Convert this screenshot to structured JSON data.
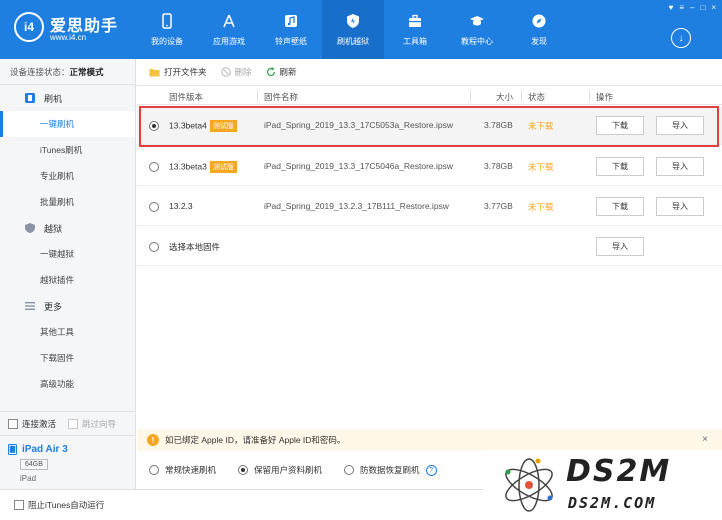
{
  "header": {
    "app_name": "爱思助手",
    "url": "www.i4.cn",
    "logo_text": "i4",
    "window_controls": [
      "♥",
      "≡",
      "–",
      "□",
      "×"
    ],
    "download_glyph": "↓",
    "nav": [
      {
        "label": "我的设备",
        "icon": "phone-icon"
      },
      {
        "label": "应用游戏",
        "icon": "app-store-icon"
      },
      {
        "label": "铃声壁纸",
        "icon": "music-icon"
      },
      {
        "label": "刷机越狱",
        "icon": "shield-icon",
        "active": true
      },
      {
        "label": "工具箱",
        "icon": "toolbox-icon"
      },
      {
        "label": "教程中心",
        "icon": "graduation-cap-icon"
      },
      {
        "label": "发现",
        "icon": "compass-icon"
      }
    ]
  },
  "sidebar": {
    "status_label": "设备连接状态：",
    "status_value": "正常模式",
    "groups": [
      {
        "label": "刷机",
        "icon": "flash-icon",
        "items": [
          "一键刷机",
          "iTunes刷机",
          "专业刷机",
          "批量刷机"
        ]
      },
      {
        "label": "越狱",
        "icon": "jailbreak-icon",
        "items": [
          "一键越狱",
          "越狱插件"
        ]
      },
      {
        "label": "更多",
        "icon": "menu-icon",
        "items": [
          "其他工具",
          "下载固件",
          "高级功能"
        ]
      }
    ],
    "active_item": "一键刷机",
    "activate_label": "连接激活",
    "skip_guide_label": "跳过向导",
    "device_name": "iPad Air 3",
    "device_capacity": "64GB",
    "device_model": "iPad"
  },
  "toolbar": {
    "open_folder": "打开文件夹",
    "delete": "删除",
    "refresh": "刷新"
  },
  "table": {
    "headers": {
      "version": "固件版本",
      "name": "固件名称",
      "size": "大小",
      "status": "状态",
      "action": "操作"
    },
    "rows": [
      {
        "version": "13.3beta4",
        "beta": "测试版",
        "name": "iPad_Spring_2019_13.3_17C5053a_Restore.ipsw",
        "size": "3.78GB",
        "status": "未下载",
        "download": "下载",
        "import": "导入",
        "selected": true
      },
      {
        "version": "13.3beta3",
        "beta": "测试版",
        "name": "iPad_Spring_2019_13.3_17C5046a_Restore.ipsw",
        "size": "3.78GB",
        "status": "未下载",
        "download": "下载",
        "import": "导入"
      },
      {
        "version": "13.2.3",
        "beta": "",
        "name": "iPad_Spring_2019_13.2.3_17B111_Restore.ipsw",
        "size": "3.77GB",
        "status": "未下载",
        "download": "下载",
        "import": "导入"
      }
    ],
    "local_label": "选择本地固件",
    "local_import": "导入"
  },
  "info": {
    "icon_glyph": "!",
    "text": "如已绑定 Apple ID，请准备好 Apple ID和密码。",
    "close_glyph": "×"
  },
  "modes": {
    "options": [
      "常规快速刷机",
      "保留用户资料刷机",
      "防数据恢复刷机"
    ],
    "selected_index": 1,
    "help_glyph": "?"
  },
  "footer": {
    "block_itunes": "阻止iTunes自动运行"
  },
  "watermark": {
    "title": "DS2M",
    "subtitle": "DS2M.COM"
  },
  "colors": {
    "brand": "#1e7fe0",
    "warning": "#f5a623",
    "highlight": "#e04040"
  }
}
